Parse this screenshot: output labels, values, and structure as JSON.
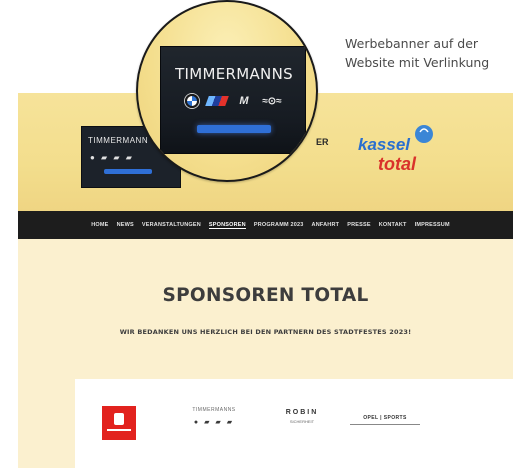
{
  "caption": {
    "line1": "Werbebanner auf der",
    "line2": "Website mit Verlinkung"
  },
  "magnifier": {
    "brand": "TIMMERMANNS",
    "logos": [
      "bmw-roundel",
      "m-stripes",
      "m-letter",
      "mini-wings"
    ]
  },
  "site": {
    "header": {
      "banner_brand": "TIMMERMANN",
      "banner_logos": "● ▰ ▰ ▰",
      "suffix_text": "ER",
      "logo_text": "kassel total"
    },
    "nav": {
      "items": [
        "HOME",
        "NEWS",
        "VERANSTALTUNGEN",
        "SPONSOREN",
        "PROGRAMM 2023",
        "ANFAHRT",
        "PRESSE",
        "KONTAKT",
        "IMPRESSUM"
      ],
      "active_index": 3
    },
    "body": {
      "title": "SPONSOREN TOTAL",
      "subtitle": "WIR BEDANKEN UNS HERZLICH BEI DEN PARTNERN DES STADTFESTES 2023!"
    },
    "sponsors": {
      "timmermanns_top": "TIMMERMANNS",
      "timmermanns_logos": "● ▰ ▰ ▰",
      "third_name": "ROBIN",
      "third_sub": "SICHERHEIT",
      "fourth_name": "OPEL | SPORTS"
    }
  },
  "colors": {
    "accent_blue": "#2f6fd6",
    "nav_bg": "#1d1d1d",
    "header_yellow": "#f4de8d",
    "body_cream": "#fbf0cf",
    "bank_red": "#e2221e"
  }
}
